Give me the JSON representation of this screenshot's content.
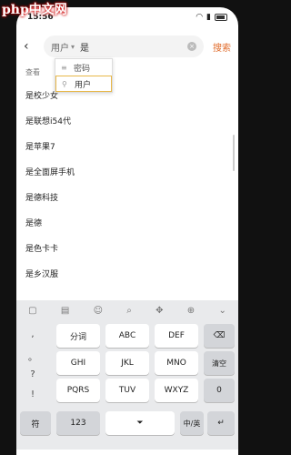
{
  "status": {
    "time": "15:56",
    "battery": ""
  },
  "watermark": "php中文网",
  "search": {
    "scope": "用户",
    "query": "是",
    "button": "搜索"
  },
  "dropdown": {
    "items": [
      {
        "label": "密码",
        "icon": "list-icon"
      },
      {
        "label": "用户",
        "icon": "user-icon"
      }
    ]
  },
  "results": {
    "hint": "查看",
    "items": [
      "是校少女",
      "是联想i54代",
      "是苹果7",
      "是全面屏手机",
      "是德科技",
      "是德",
      "是色卡卡",
      "是乡汉服"
    ]
  },
  "keyboard": {
    "toolbar": [
      "▢",
      "▤",
      "☺",
      "⌕",
      "✥",
      "⊕",
      "⌄"
    ],
    "left_col": [
      ",",
      "。",
      "?",
      "!"
    ],
    "row1": [
      "分词",
      "ABC",
      "DEF"
    ],
    "row2": [
      "GHI",
      "JKL",
      "MNO"
    ],
    "row3": [
      "PQRS",
      "TUV",
      "WXYZ"
    ],
    "right": {
      "backspace": "⌫",
      "clear": "清空",
      "zero": "0"
    },
    "bottom": {
      "symbol": "符",
      "num": "123",
      "space": "⏷",
      "lang": "中/英",
      "enter": "↵"
    }
  }
}
